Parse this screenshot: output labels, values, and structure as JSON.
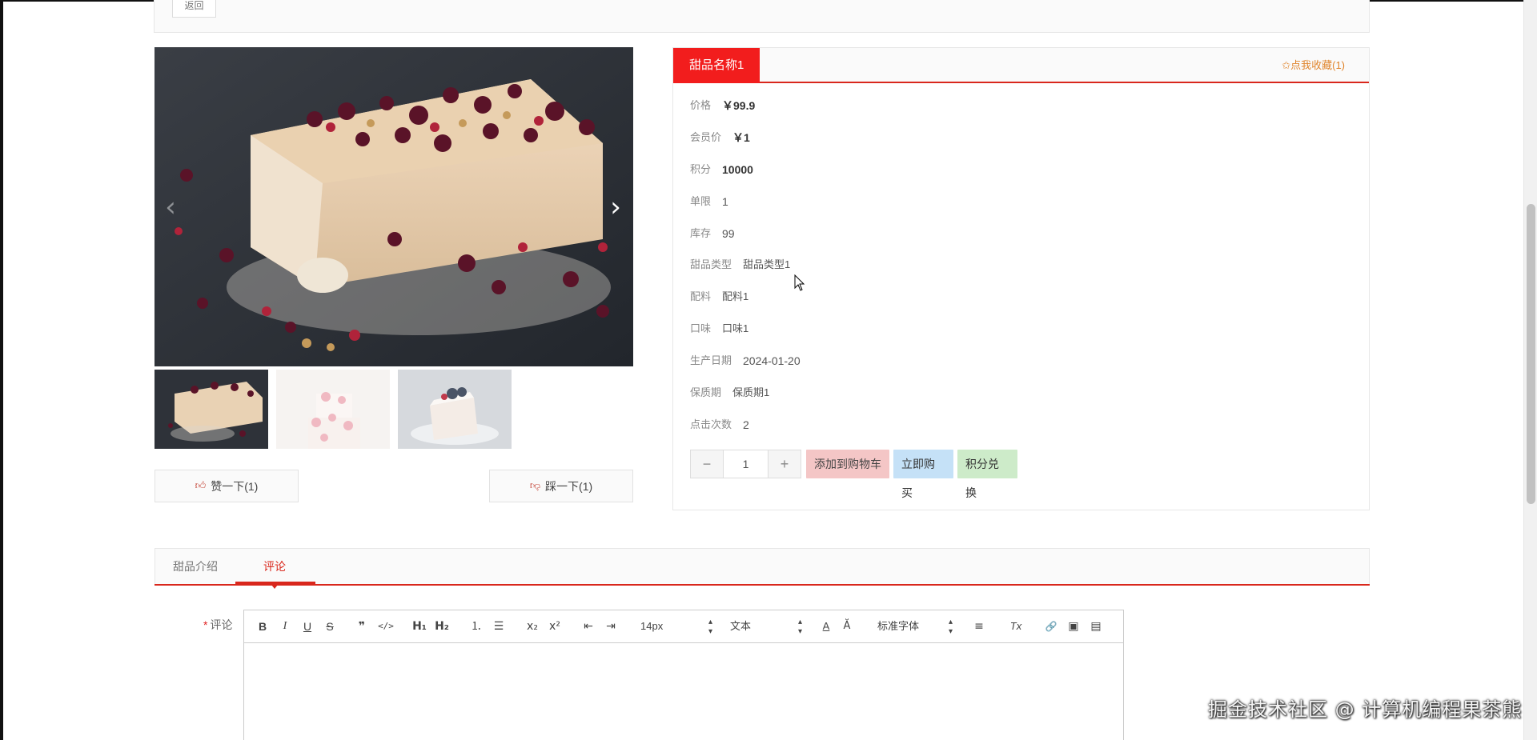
{
  "page": {
    "back_label": "返回",
    "accent_color": "#f21d1d"
  },
  "gallery": {
    "prev_icon": "chevron-left-icon",
    "next_icon": "chevron-right-icon",
    "thumbnails": [
      "thumbnail-1",
      "thumbnail-2",
      "thumbnail-3"
    ],
    "like_label": "赞一下(1)",
    "dislike_label": "踩一下(1)"
  },
  "product": {
    "title": "甜品名称1",
    "favorite_label": "✩点我收藏(1)",
    "attributes": [
      {
        "label": "价格",
        "value": "￥99.9"
      },
      {
        "label": "会员价",
        "value": "￥1"
      },
      {
        "label": "积分",
        "value": "10000"
      },
      {
        "label": "单限",
        "value": "1"
      },
      {
        "label": "库存",
        "value": "99"
      },
      {
        "label": "甜品类型",
        "value": "甜品类型1"
      },
      {
        "label": "配料",
        "value": "配料1"
      },
      {
        "label": "口味",
        "value": "口味1"
      },
      {
        "label": "生产日期",
        "value": "2024-01-20"
      },
      {
        "label": "保质期",
        "value": "保质期1"
      },
      {
        "label": "点击次数",
        "value": "2"
      }
    ],
    "quantity": "1",
    "minus_label": "−",
    "plus_label": "+",
    "add_to_cart_label": "添加到购物车",
    "buy_now_label": "立即购买",
    "points_exchange_label": "积分兑换"
  },
  "tabs": [
    {
      "label": "甜品介绍",
      "active": false
    },
    {
      "label": "评论",
      "active": true
    }
  ],
  "comment": {
    "required_mark": "*",
    "label": "评论",
    "toolbar": {
      "bold": "B",
      "italic": "I",
      "underline": "U",
      "strike": "S",
      "quote": "❞",
      "code": "</>",
      "h1": "H₁",
      "h2": "H₂",
      "ordered_list": "⒈",
      "bullet_list": "☰",
      "subscript": "x₂",
      "superscript": "x²",
      "outdent": "⇤",
      "indent": "⇥",
      "size": "14px",
      "header": "文本",
      "font": "标准字体",
      "color": "A",
      "background": "Ă",
      "align": "≡",
      "clean": "Tx",
      "link": "🔗",
      "image": "▣",
      "video": "▤"
    }
  },
  "watermark": "掘金技术社区 @ 计算机编程果茶熊"
}
